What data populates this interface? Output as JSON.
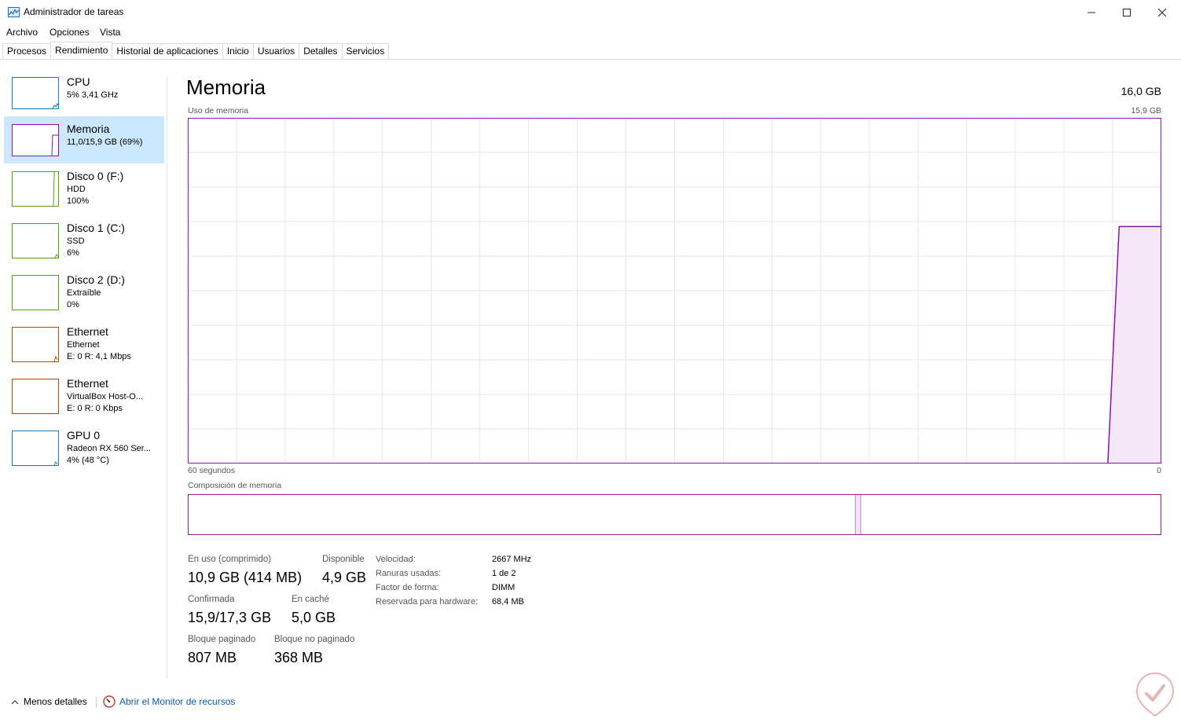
{
  "window": {
    "title": "Administrador de tareas",
    "icon": "task-manager-icon"
  },
  "menu": [
    "Archivo",
    "Opciones",
    "Vista"
  ],
  "tabs": [
    "Procesos",
    "Rendimiento",
    "Historial de aplicaciones",
    "Inicio",
    "Usuarios",
    "Detalles",
    "Servicios"
  ],
  "active_tab": "Rendimiento",
  "sidebar": {
    "items": [
      {
        "name": "CPU",
        "line1": "5%  3,41 GHz",
        "line2": "",
        "color": "#117dbb"
      },
      {
        "name": "Memoria",
        "line1": "11,0/15,9 GB (69%)",
        "line2": "",
        "color": "#8b12ae",
        "selected": true
      },
      {
        "name": "Disco 0 (F:)",
        "line1": "HDD",
        "line2": "100%",
        "color": "#4da60c"
      },
      {
        "name": "Disco 1 (C:)",
        "line1": "SSD",
        "line2": "6%",
        "color": "#4da60c"
      },
      {
        "name": "Disco 2 (D:)",
        "line1": "Extraíble",
        "line2": "0%",
        "color": "#4da60c"
      },
      {
        "name": "Ethernet",
        "line1": "Ethernet",
        "line2": "E: 0 R: 4,1 Mbps",
        "color": "#a74f01"
      },
      {
        "name": "Ethernet",
        "line1": "VirtualBox Host-O...",
        "line2": "E: 0 R: 0 Kbps",
        "color": "#a74f01"
      },
      {
        "name": "GPU 0",
        "line1": "Radeon RX 560 Ser...",
        "line2": "4% (48 °C)",
        "color": "#117dbb"
      }
    ]
  },
  "main": {
    "title": "Memoria",
    "total": "16,0 GB",
    "usage_label": "Uso de memoria",
    "usage_max": "15,9 GB",
    "x_left": "60 segundos",
    "x_right": "0",
    "composition_label": "Composición de memoria",
    "accent_color": "#8b12ae",
    "grid_color": "#f0dff4"
  },
  "chart_data": {
    "type": "line",
    "title": "Uso de memoria",
    "xlabel": "",
    "ylabel": "",
    "x": [
      60,
      3.3,
      2.6,
      1.5,
      0
    ],
    "series": [
      {
        "values": [
          0,
          0,
          10.9,
          10.9,
          10.9
        ]
      }
    ],
    "ylim": [
      0,
      15.9
    ],
    "xlim": [
      60,
      0
    ],
    "grid": true
  },
  "stats": {
    "in_use_label": "En uso (comprimido)",
    "in_use_value": "10,9 GB (414 MB)",
    "available_label": "Disponible",
    "available_value": "4,9 GB",
    "committed_label": "Confirmada",
    "committed_value": "15,9/17,3 GB",
    "cached_label": "En caché",
    "cached_value": "5,0 GB",
    "paged_label": "Bloque paginado",
    "paged_value": "807 MB",
    "nonpaged_label": "Bloque no paginado",
    "nonpaged_value": "368 MB"
  },
  "details": [
    {
      "key": "Velocidad:",
      "value": "2667 MHz"
    },
    {
      "key": "Ranuras usadas:",
      "value": "1 de 2"
    },
    {
      "key": "Factor de forma:",
      "value": "DIMM"
    },
    {
      "key": "Reservada para hardware:",
      "value": "68,4 MB"
    }
  ],
  "footer": {
    "fewer_details": "Menos detalles",
    "resource_monitor": "Abrir el Monitor de recursos"
  }
}
